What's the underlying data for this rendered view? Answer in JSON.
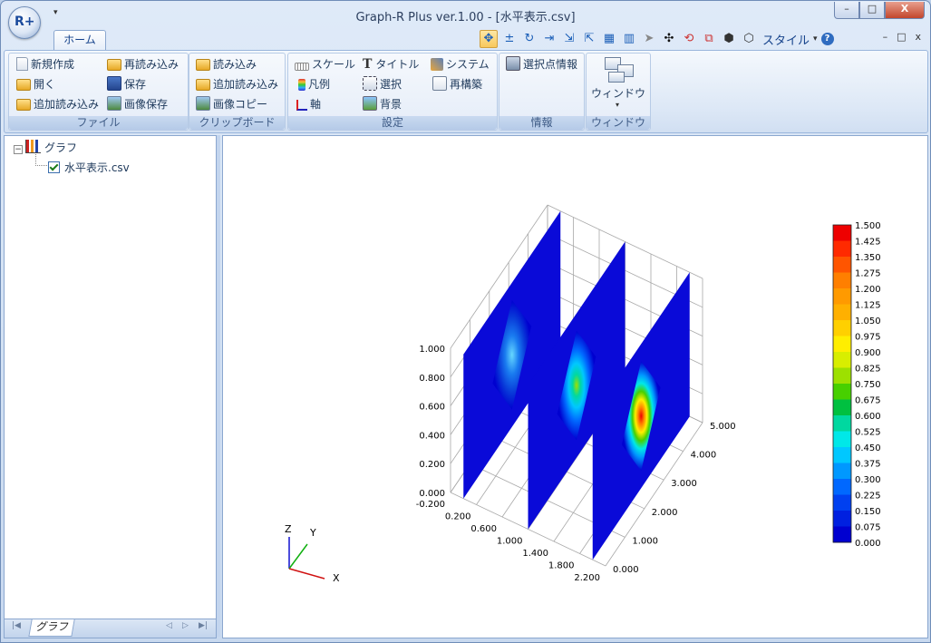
{
  "window": {
    "title": "Graph-R Plus ver.1.00 - [水平表示.csv]",
    "app_logo": "R+",
    "buttons": {
      "minimize": "–",
      "maximize": "□",
      "close": "X"
    }
  },
  "ribbon_tab": "ホーム",
  "toolbar": {
    "icons": [
      "move-icon",
      "plus-minus-icon",
      "rotate-icon",
      "scale-x-icon",
      "scale-xy-icon",
      "scale-xz-icon",
      "color-scale-icon",
      "color-scale-b-icon",
      "pointer-icon",
      "pan-icon",
      "reset-rotate-icon",
      "zoom-window-icon",
      "box-icon",
      "cube-icon"
    ],
    "style_label": "スタイル",
    "help": "?",
    "mdi": [
      "–",
      "□",
      "x"
    ]
  },
  "groups": {
    "file": {
      "label": "ファイル",
      "new": "新規作成",
      "open": "開く",
      "append_load": "追加読み込み",
      "reload": "再読み込み",
      "save": "保存",
      "save_image": "画像保存"
    },
    "clipboard": {
      "label": "クリップボード",
      "load": "読み込み",
      "append_load": "追加読み込み",
      "copy_image": "画像コピー"
    },
    "settings": {
      "label": "設定",
      "scale": "スケール",
      "title": "タイトル",
      "system": "システム",
      "legend": "凡例",
      "select": "選択",
      "rebuild": "再構築",
      "axis": "軸",
      "background": "背景"
    },
    "info": {
      "label": "情報",
      "selected_point": "選択点情報"
    },
    "window": {
      "label": "ウィンドウ",
      "window_button": "ウィンドウ"
    }
  },
  "tree": {
    "root": "グラフ",
    "child": "水平表示.csv",
    "expander": "⊟"
  },
  "bottom_tab": "グラフ",
  "axes_indicator": {
    "x": "X",
    "y": "Y",
    "z": "Z"
  },
  "colors": {
    "ribbon_text": "#1e395b",
    "plot_blue": "#1a1ad9"
  },
  "chart_data": {
    "type": "surface3d",
    "title": "",
    "x_ticks": [
      "-0.200",
      "0.200",
      "0.600",
      "1.000",
      "1.400",
      "1.800",
      "2.200"
    ],
    "y_ticks": [
      "0.000",
      "1.000",
      "2.000",
      "3.000",
      "4.000",
      "5.000"
    ],
    "z_ticks": [
      "0.000",
      "0.200",
      "0.400",
      "0.600",
      "0.800",
      "1.000"
    ],
    "xlim": [
      -0.2,
      2.2
    ],
    "ylim": [
      0,
      5
    ],
    "zlim": [
      0,
      1
    ],
    "panels": [
      {
        "x": 0,
        "peak": 0.35
      },
      {
        "x": 1,
        "peak": 0.85
      },
      {
        "x": 2,
        "peak": 1.5
      }
    ],
    "colorbar": {
      "min": 0,
      "max": 1.5,
      "labels": [
        "1.500",
        "1.425",
        "1.350",
        "1.275",
        "1.200",
        "1.125",
        "1.050",
        "0.975",
        "0.900",
        "0.825",
        "0.750",
        "0.675",
        "0.600",
        "0.525",
        "0.450",
        "0.375",
        "0.300",
        "0.225",
        "0.150",
        "0.075",
        "0.000"
      ],
      "colors": [
        "#ee0000",
        "#ff2a00",
        "#ff5500",
        "#ff7f00",
        "#ff9a00",
        "#ffb000",
        "#ffd000",
        "#ffee00",
        "#d8ee00",
        "#9de000",
        "#47d000",
        "#00c040",
        "#00d8a0",
        "#00e8e8",
        "#00c8ff",
        "#0098ff",
        "#0068ff",
        "#0040f0",
        "#0020e0",
        "#0000d0"
      ]
    }
  }
}
